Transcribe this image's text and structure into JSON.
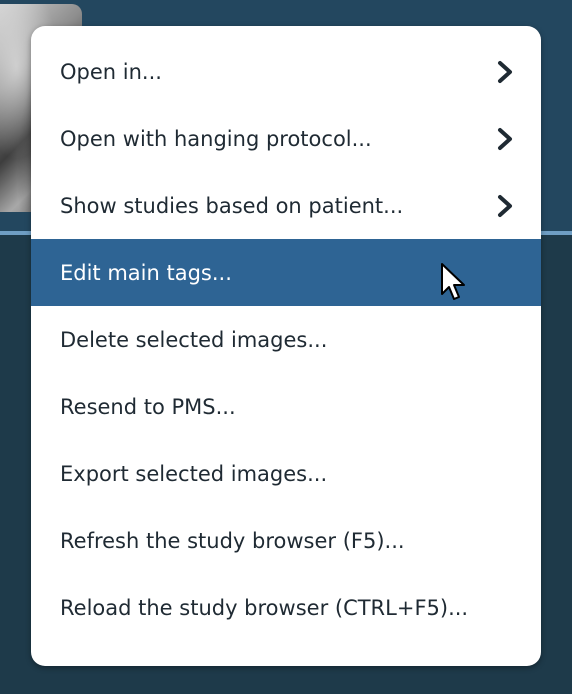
{
  "context_menu": {
    "items": [
      {
        "label": "Open in...",
        "has_submenu": true,
        "highlighted": false
      },
      {
        "label": "Open with hanging protocol...",
        "has_submenu": true,
        "highlighted": false
      },
      {
        "label": "Show studies based on patient...",
        "has_submenu": true,
        "highlighted": false
      },
      {
        "label": "Edit main tags...",
        "has_submenu": false,
        "highlighted": true
      },
      {
        "label": "Delete selected images...",
        "has_submenu": false,
        "highlighted": false
      },
      {
        "label": "Resend to PMS...",
        "has_submenu": false,
        "highlighted": false
      },
      {
        "label": "Export selected images...",
        "has_submenu": false,
        "highlighted": false
      },
      {
        "label": "Refresh the study browser (F5)...",
        "has_submenu": false,
        "highlighted": false
      },
      {
        "label": "Reload the study browser (CTRL+F5)...",
        "has_submenu": false,
        "highlighted": false
      }
    ]
  },
  "icons": {
    "submenu": "chevron-right-icon",
    "pointer": "mouse-pointer-icon"
  },
  "colors": {
    "highlight": "#2e6494",
    "menu_background": "#ffffff",
    "menu_text": "#1f2a33",
    "app_background": "#23475f",
    "divider": "#6f9ec4"
  }
}
